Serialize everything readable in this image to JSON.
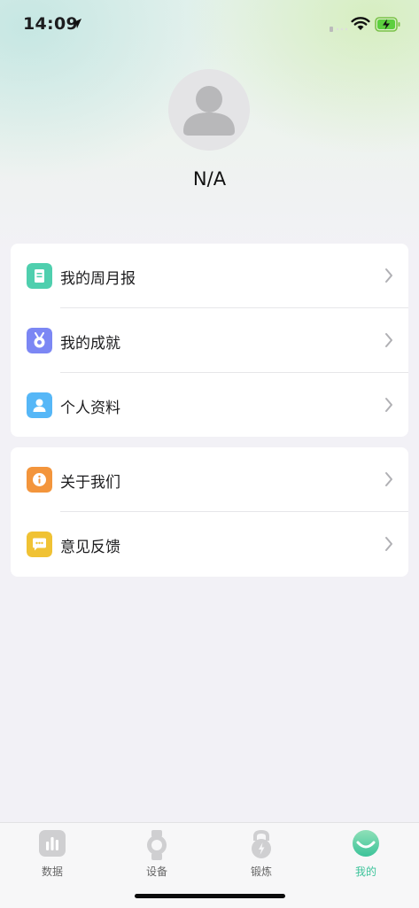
{
  "status_bar": {
    "time": "14:09",
    "icons": [
      "location-arrow-icon",
      "wifi-icon",
      "battery-charging-icon"
    ]
  },
  "profile": {
    "name": "N/A",
    "avatar_icon": "person-icon"
  },
  "menu_group_1": [
    {
      "label": "我的周月报",
      "icon": "report-icon",
      "color": "#4fcfae"
    },
    {
      "label": "我的成就",
      "icon": "medal-icon",
      "color": "#7c87f4"
    },
    {
      "label": "个人资料",
      "icon": "user-icon",
      "color": "#56b7f7"
    }
  ],
  "menu_group_2": [
    {
      "label": "关于我们",
      "icon": "info-icon",
      "color": "#f3953c"
    },
    {
      "label": "意见反馈",
      "icon": "feedback-icon",
      "color": "#f0c234"
    }
  ],
  "tabbar": [
    {
      "label": "数据",
      "icon": "bar-chart-icon"
    },
    {
      "label": "设备",
      "icon": "watch-icon"
    },
    {
      "label": "锻炼",
      "icon": "kettlebell-icon"
    },
    {
      "label": "我的",
      "icon": "smile-icon",
      "active": true
    }
  ],
  "colors": {
    "accent": "#3cc39a",
    "background": "#f2f1f6"
  }
}
